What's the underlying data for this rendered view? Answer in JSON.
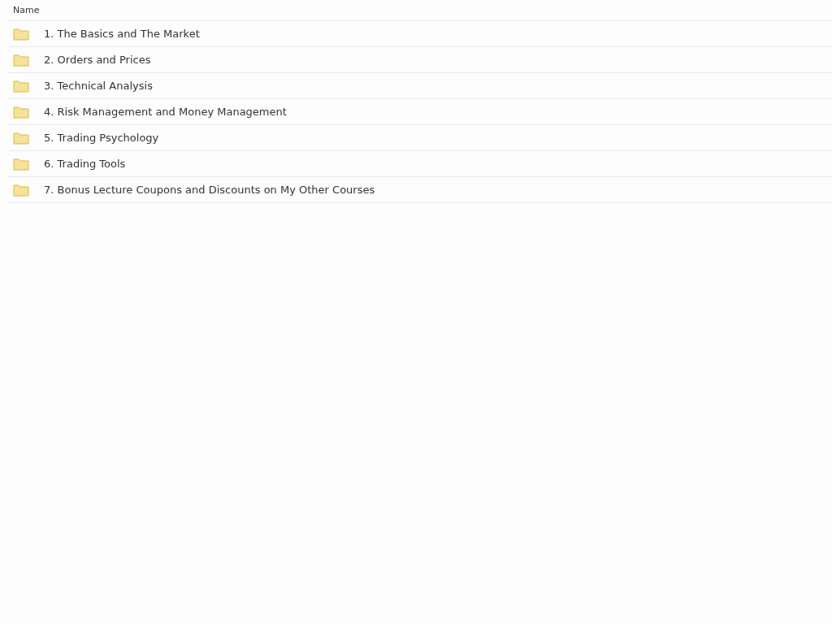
{
  "table": {
    "columns": [
      "Name"
    ],
    "rows": [
      {
        "kind": "folder",
        "name": "1. The Basics and The Market"
      },
      {
        "kind": "folder",
        "name": "2. Orders and Prices"
      },
      {
        "kind": "folder",
        "name": "3. Technical Analysis"
      },
      {
        "kind": "folder",
        "name": "4. Risk Management and Money Management"
      },
      {
        "kind": "folder",
        "name": "5. Trading Psychology"
      },
      {
        "kind": "folder",
        "name": "6. Trading Tools"
      },
      {
        "kind": "folder",
        "name": "7. Bonus Lecture Coupons and Discounts on My Other Courses"
      }
    ]
  }
}
